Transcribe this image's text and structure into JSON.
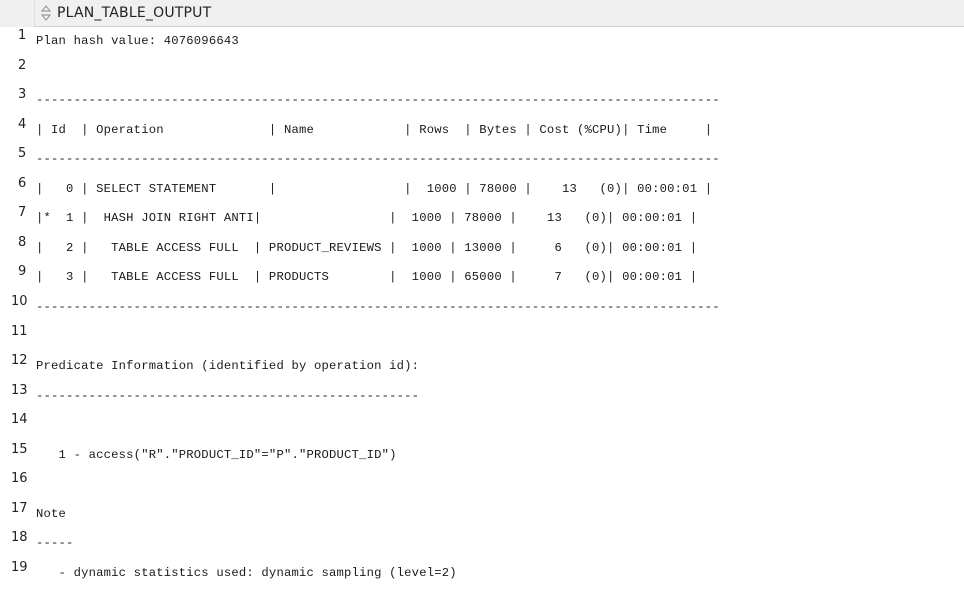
{
  "grid": {
    "column_header": "PLAN_TABLE_OUTPUT",
    "sort_icon": "sort-arrows-icon",
    "rows": [
      {
        "num": "1",
        "text": "Plan hash value: 4076096643"
      },
      {
        "num": "2",
        "text": ""
      },
      {
        "num": "3",
        "text": "-------------------------------------------------------------------------------------------"
      },
      {
        "num": "4",
        "text": "| Id  | Operation              | Name            | Rows  | Bytes | Cost (%CPU)| Time     |"
      },
      {
        "num": "5",
        "text": "-------------------------------------------------------------------------------------------"
      },
      {
        "num": "6",
        "text": "|   0 | SELECT STATEMENT       |                 |  1000 | 78000 |    13   (0)| 00:00:01 |"
      },
      {
        "num": "7",
        "text": "|*  1 |  HASH JOIN RIGHT ANTI|                 |  1000 | 78000 |    13   (0)| 00:00:01 |"
      },
      {
        "num": "8",
        "text": "|   2 |   TABLE ACCESS FULL  | PRODUCT_REVIEWS |  1000 | 13000 |     6   (0)| 00:00:01 |"
      },
      {
        "num": "9",
        "text": "|   3 |   TABLE ACCESS FULL  | PRODUCTS        |  1000 | 65000 |     7   (0)| 00:00:01 |"
      },
      {
        "num": "10",
        "text": "-------------------------------------------------------------------------------------------"
      },
      {
        "num": "11",
        "text": ""
      },
      {
        "num": "12",
        "text": "Predicate Information (identified by operation id):"
      },
      {
        "num": "13",
        "text": "---------------------------------------------------"
      },
      {
        "num": "14",
        "text": ""
      },
      {
        "num": "15",
        "text": "   1 - access(\"R\".\"PRODUCT_ID\"=\"P\".\"PRODUCT_ID\")"
      },
      {
        "num": "16",
        "text": ""
      },
      {
        "num": "17",
        "text": "Note"
      },
      {
        "num": "18",
        "text": "-----"
      },
      {
        "num": "19",
        "text": "   - dynamic statistics used: dynamic sampling (level=2)"
      }
    ]
  }
}
